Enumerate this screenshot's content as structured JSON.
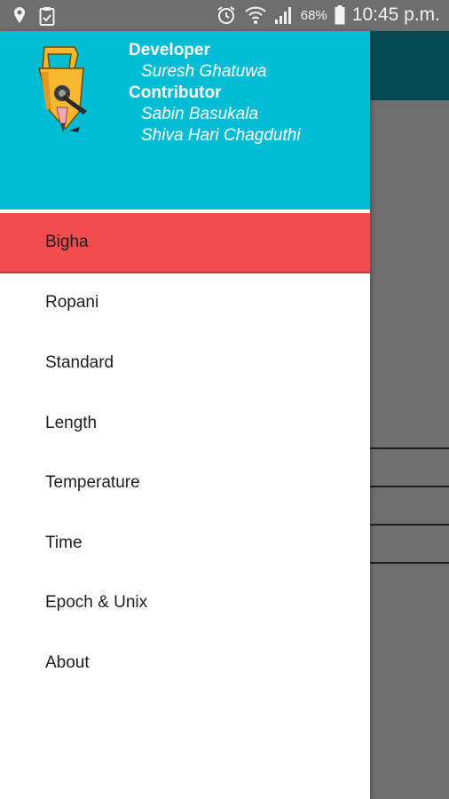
{
  "status_bar": {
    "battery_percent": "68%",
    "time": "10:45 p.m."
  },
  "drawer": {
    "header": {
      "developer_heading": "Developer",
      "developer_name": "Suresh Ghatuwa",
      "contributor_heading": "Contributor",
      "contributors": [
        "Sabin Basukala",
        "Shiva Hari Chagduthi"
      ]
    },
    "menu": [
      {
        "label": "Bigha",
        "selected": true
      },
      {
        "label": "Ropani",
        "selected": false
      },
      {
        "label": "Standard",
        "selected": false
      },
      {
        "label": "Length",
        "selected": false
      },
      {
        "label": "Temperature",
        "selected": false
      },
      {
        "label": "Time",
        "selected": false
      },
      {
        "label": "Epoch & Unix",
        "selected": false
      },
      {
        "label": "About",
        "selected": false
      }
    ]
  },
  "colors": {
    "header_bg": "#00bcd4",
    "selected_item_bg": "#f24c4f",
    "app_bar_bg": "#034a55",
    "status_bar_bg": "#6e6e6e"
  },
  "icons": [
    "location-pin-icon",
    "clipboard-icon",
    "alarm-icon",
    "wifi-icon",
    "signal-icon",
    "battery-icon",
    "measuring-tape-logo"
  ]
}
